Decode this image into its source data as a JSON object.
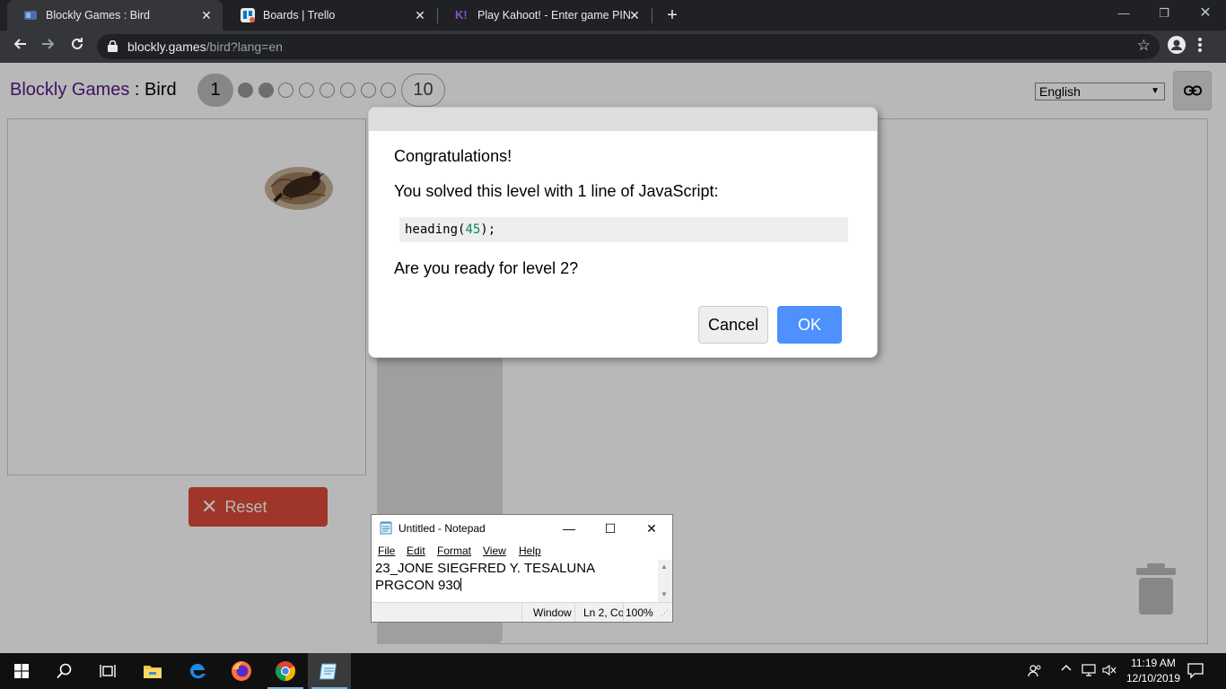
{
  "browser": {
    "tabs": [
      {
        "title": "Blockly Games : Bird",
        "active": true
      },
      {
        "title": "Boards | Trello",
        "active": false
      },
      {
        "title": "Play Kahoot! - Enter game PIN he",
        "active": false
      }
    ],
    "url_host": "blockly.games",
    "url_path": "/bird?lang=en"
  },
  "app": {
    "brand_name": "Blockly Games",
    "brand_sep": " : ",
    "game_name": "Bird",
    "current_level": "1",
    "last_level": "10",
    "language": "English",
    "reset_label": "Reset"
  },
  "dialog": {
    "heading": "Congratulations!",
    "solved_text": "You solved this level with 1 line of JavaScript:",
    "code_fn": "heading(",
    "code_arg": "45",
    "code_end": ");",
    "question": "Are you ready for level 2?",
    "cancel_label": "Cancel",
    "ok_label": "OK"
  },
  "notepad": {
    "title": "Untitled - Notepad",
    "menu": [
      "File",
      "Edit",
      "Format",
      "View",
      "Help"
    ],
    "lines": [
      "23_JONE SIEGFRED Y. TESALUNA",
      "PRGCON 930"
    ],
    "status_eol": "Window",
    "status_pos": "Ln 2, Co",
    "status_zoom": "100%"
  },
  "taskbar": {
    "time": "11:19 AM",
    "date": "12/10/2019"
  },
  "colors": {
    "reset": "#dd4b39",
    "ok": "#4d90fe",
    "brand_link": "#551a8b"
  }
}
